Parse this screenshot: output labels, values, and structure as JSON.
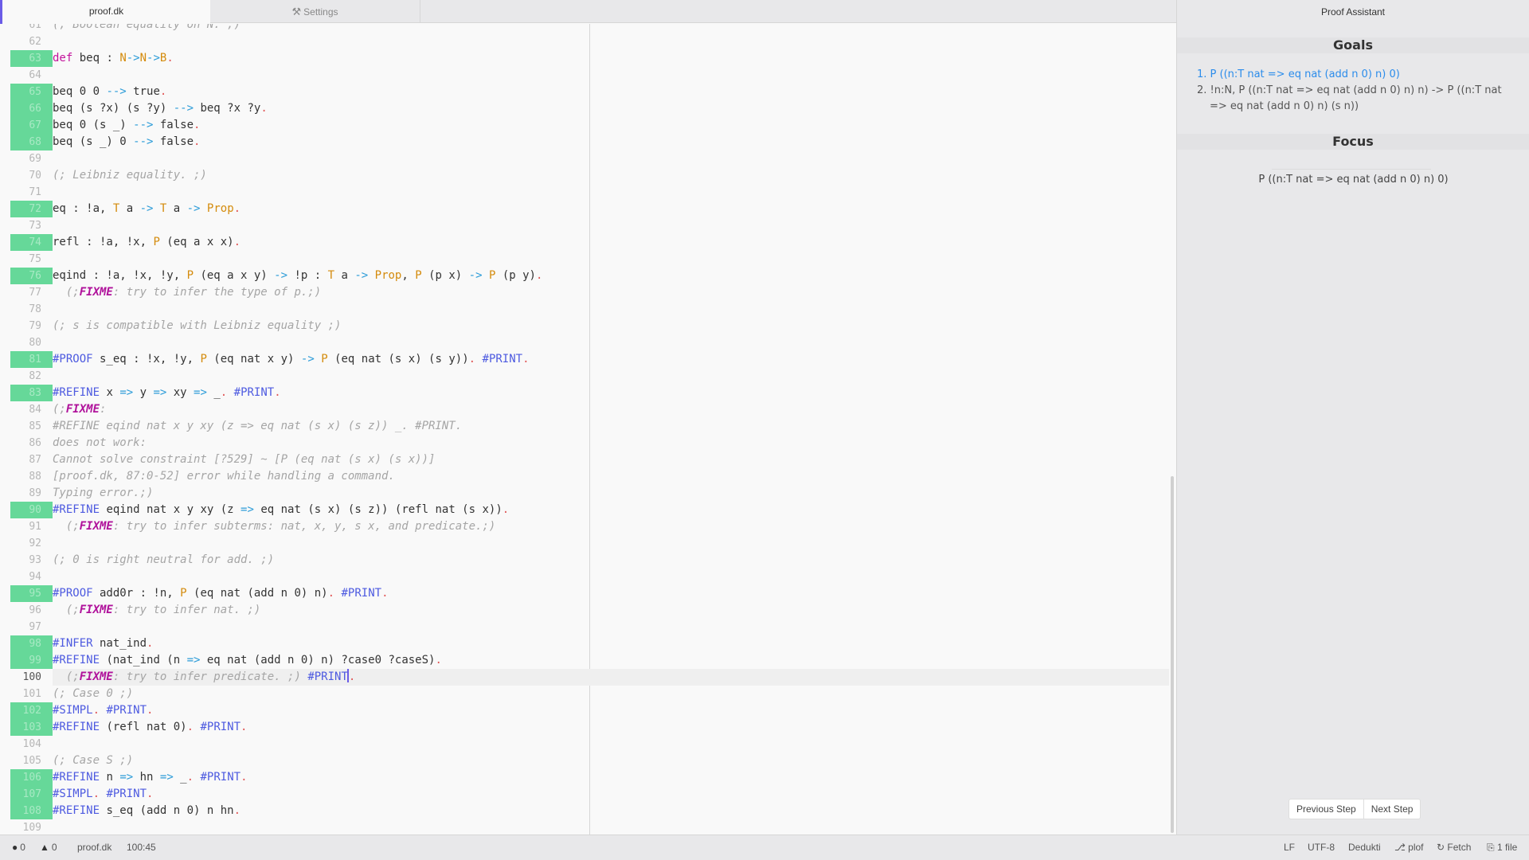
{
  "tabs": [
    {
      "label": "proof.dk",
      "active": true
    },
    {
      "label": "Settings",
      "icon": "tools-icon",
      "active": false
    }
  ],
  "editor": {
    "cursor_line": 100,
    "lines": [
      {
        "n": "61",
        "ok": false,
        "tokens": [
          [
            "cm",
            "(; Boolean equality on N. ;)"
          ]
        ]
      },
      {
        "n": "62",
        "ok": false,
        "tokens": []
      },
      {
        "n": "63",
        "ok": true,
        "tokens": [
          [
            "kw",
            "def"
          ],
          [
            "",
            " beq : "
          ],
          [
            "ty",
            "N"
          ],
          [
            "ar",
            "->"
          ],
          [
            "ty",
            "N"
          ],
          [
            "ar",
            "->"
          ],
          [
            "ty",
            "B"
          ],
          [
            "dot",
            "."
          ]
        ]
      },
      {
        "n": "64",
        "ok": false,
        "tokens": []
      },
      {
        "n": "65",
        "ok": true,
        "tokens": [
          [
            "",
            "beq 0 0 "
          ],
          [
            "ar",
            "-->"
          ],
          [
            "",
            " true"
          ],
          [
            "dot",
            "."
          ]
        ]
      },
      {
        "n": "66",
        "ok": true,
        "tokens": [
          [
            "",
            "beq (s ?x) (s ?y) "
          ],
          [
            "ar",
            "-->"
          ],
          [
            "",
            " beq ?x ?y"
          ],
          [
            "dot",
            "."
          ]
        ]
      },
      {
        "n": "67",
        "ok": true,
        "tokens": [
          [
            "",
            "beq 0 (s _) "
          ],
          [
            "ar",
            "-->"
          ],
          [
            "",
            " false"
          ],
          [
            "dot",
            "."
          ]
        ]
      },
      {
        "n": "68",
        "ok": true,
        "tokens": [
          [
            "",
            "beq (s _) 0 "
          ],
          [
            "ar",
            "-->"
          ],
          [
            "",
            " false"
          ],
          [
            "dot",
            "."
          ]
        ]
      },
      {
        "n": "69",
        "ok": false,
        "tokens": []
      },
      {
        "n": "70",
        "ok": false,
        "tokens": [
          [
            "cm",
            "(; Leibniz equality. ;)"
          ]
        ]
      },
      {
        "n": "71",
        "ok": false,
        "tokens": []
      },
      {
        "n": "72",
        "ok": true,
        "tokens": [
          [
            "",
            "eq : !a, "
          ],
          [
            "ty",
            "T"
          ],
          [
            "",
            " a "
          ],
          [
            "ar",
            "->"
          ],
          [
            "",
            " "
          ],
          [
            "ty",
            "T"
          ],
          [
            "",
            " a "
          ],
          [
            "ar",
            "->"
          ],
          [
            "",
            " "
          ],
          [
            "ty",
            "Prop"
          ],
          [
            "dot",
            "."
          ]
        ]
      },
      {
        "n": "73",
        "ok": false,
        "tokens": []
      },
      {
        "n": "74",
        "ok": true,
        "tokens": [
          [
            "",
            "refl : !a, !x, "
          ],
          [
            "ty",
            "P"
          ],
          [
            "",
            " (eq a x x)"
          ],
          [
            "dot",
            "."
          ]
        ]
      },
      {
        "n": "75",
        "ok": false,
        "tokens": []
      },
      {
        "n": "76",
        "ok": true,
        "tokens": [
          [
            "",
            "eqind : !a, !x, !y, "
          ],
          [
            "ty",
            "P"
          ],
          [
            "",
            " (eq a x y) "
          ],
          [
            "ar",
            "->"
          ],
          [
            "",
            " !p : "
          ],
          [
            "ty",
            "T"
          ],
          [
            "",
            " a "
          ],
          [
            "ar",
            "->"
          ],
          [
            "",
            " "
          ],
          [
            "ty",
            "Prop"
          ],
          [
            "",
            ", "
          ],
          [
            "ty",
            "P"
          ],
          [
            "",
            " (p x) "
          ],
          [
            "ar",
            "->"
          ],
          [
            "",
            " "
          ],
          [
            "ty",
            "P"
          ],
          [
            "",
            " (p y)"
          ],
          [
            "dot",
            "."
          ]
        ]
      },
      {
        "n": "77",
        "ok": false,
        "tokens": [
          [
            "cm",
            "  (;"
          ],
          [
            "fx",
            "FIXME"
          ],
          [
            "cm",
            ": try to infer the type of p.;)"
          ]
        ]
      },
      {
        "n": "78",
        "ok": false,
        "tokens": []
      },
      {
        "n": "79",
        "ok": false,
        "tokens": [
          [
            "cm",
            "(; s is compatible with Leibniz equality ;)"
          ]
        ]
      },
      {
        "n": "80",
        "ok": false,
        "tokens": []
      },
      {
        "n": "81",
        "ok": true,
        "tokens": [
          [
            "cmd",
            "#PROOF"
          ],
          [
            "",
            " s_eq : !x, !y, "
          ],
          [
            "ty",
            "P"
          ],
          [
            "",
            " (eq nat x y) "
          ],
          [
            "ar",
            "->"
          ],
          [
            "",
            " "
          ],
          [
            "ty",
            "P"
          ],
          [
            "",
            " (eq nat (s x) (s y))"
          ],
          [
            "dot",
            "."
          ],
          [
            "",
            " "
          ],
          [
            "cmd",
            "#PRINT"
          ],
          [
            "dot",
            "."
          ]
        ]
      },
      {
        "n": "82",
        "ok": false,
        "tokens": []
      },
      {
        "n": "83",
        "ok": true,
        "tokens": [
          [
            "cmd",
            "#REFINE"
          ],
          [
            "",
            " x "
          ],
          [
            "ar",
            "=>"
          ],
          [
            "",
            " y "
          ],
          [
            "ar",
            "=>"
          ],
          [
            "",
            " xy "
          ],
          [
            "ar",
            "=>"
          ],
          [
            "",
            " _"
          ],
          [
            "dot",
            "."
          ],
          [
            "",
            " "
          ],
          [
            "cmd",
            "#PRINT"
          ],
          [
            "dot",
            "."
          ]
        ]
      },
      {
        "n": "84",
        "ok": false,
        "tokens": [
          [
            "cm",
            "(;"
          ],
          [
            "fx",
            "FIXME"
          ],
          [
            "cm",
            ":"
          ]
        ]
      },
      {
        "n": "85",
        "ok": false,
        "tokens": [
          [
            "cm",
            "#REFINE eqind nat x y xy (z => eq nat (s x) (s z)) _. #PRINT."
          ]
        ]
      },
      {
        "n": "86",
        "ok": false,
        "tokens": [
          [
            "cm",
            "does not work:"
          ]
        ]
      },
      {
        "n": "87",
        "ok": false,
        "tokens": [
          [
            "cm",
            "Cannot solve constraint [?529] ~ [P (eq nat (s x) (s x))]"
          ]
        ]
      },
      {
        "n": "88",
        "ok": false,
        "tokens": [
          [
            "cm",
            "[proof.dk, 87:0-52] error while handling a command."
          ]
        ]
      },
      {
        "n": "89",
        "ok": false,
        "tokens": [
          [
            "cm",
            "Typing error.;)"
          ]
        ]
      },
      {
        "n": "90",
        "ok": true,
        "tokens": [
          [
            "cmd",
            "#REFINE"
          ],
          [
            "",
            " eqind nat x y xy (z "
          ],
          [
            "ar",
            "=>"
          ],
          [
            "",
            " eq nat (s x) (s z)) (refl nat (s x))"
          ],
          [
            "dot",
            "."
          ]
        ]
      },
      {
        "n": "91",
        "ok": false,
        "tokens": [
          [
            "cm",
            "  (;"
          ],
          [
            "fx",
            "FIXME"
          ],
          [
            "cm",
            ": try to infer subterms: nat, x, y, s x, and predicate.;)"
          ]
        ]
      },
      {
        "n": "92",
        "ok": false,
        "tokens": []
      },
      {
        "n": "93",
        "ok": false,
        "tokens": [
          [
            "cm",
            "(; 0 is right neutral for add. ;)"
          ]
        ]
      },
      {
        "n": "94",
        "ok": false,
        "tokens": []
      },
      {
        "n": "95",
        "ok": true,
        "tokens": [
          [
            "cmd",
            "#PROOF"
          ],
          [
            "",
            " add0r : !n, "
          ],
          [
            "ty",
            "P"
          ],
          [
            "",
            " (eq nat (add n 0) n)"
          ],
          [
            "dot",
            "."
          ],
          [
            "",
            " "
          ],
          [
            "cmd",
            "#PRINT"
          ],
          [
            "dot",
            "."
          ]
        ]
      },
      {
        "n": "96",
        "ok": false,
        "tokens": [
          [
            "cm",
            "  (;"
          ],
          [
            "fx",
            "FIXME"
          ],
          [
            "cm",
            ": try to infer nat. ;)"
          ]
        ]
      },
      {
        "n": "97",
        "ok": false,
        "tokens": []
      },
      {
        "n": "98",
        "ok": true,
        "tokens": [
          [
            "cmd",
            "#INFER"
          ],
          [
            "",
            " nat_ind"
          ],
          [
            "dot",
            "."
          ]
        ]
      },
      {
        "n": "99",
        "ok": true,
        "tokens": [
          [
            "cmd",
            "#REFINE"
          ],
          [
            "",
            " (nat_ind (n "
          ],
          [
            "ar",
            "=>"
          ],
          [
            "",
            " eq nat (add n 0) n) ?case0 ?caseS)"
          ],
          [
            "dot",
            "."
          ]
        ]
      },
      {
        "n": "100",
        "ok": false,
        "current": true,
        "tokens": [
          [
            "cm",
            "  (;"
          ],
          [
            "fx",
            "FIXME"
          ],
          [
            "cm",
            ": try to infer predicate. ;)"
          ],
          [
            "",
            " "
          ],
          [
            "cmd",
            "#PRINT"
          ],
          [
            "cursor",
            ""
          ],
          [
            "dot",
            "."
          ]
        ]
      },
      {
        "n": "101",
        "ok": false,
        "tokens": [
          [
            "cm",
            "(; Case 0 ;)"
          ]
        ]
      },
      {
        "n": "102",
        "ok": true,
        "tokens": [
          [
            "cmd",
            "#SIMPL"
          ],
          [
            "dot",
            "."
          ],
          [
            "",
            " "
          ],
          [
            "cmd",
            "#PRINT"
          ],
          [
            "dot",
            "."
          ]
        ]
      },
      {
        "n": "103",
        "ok": true,
        "tokens": [
          [
            "cmd",
            "#REFINE"
          ],
          [
            "",
            " (refl nat 0)"
          ],
          [
            "dot",
            "."
          ],
          [
            "",
            " "
          ],
          [
            "cmd",
            "#PRINT"
          ],
          [
            "dot",
            "."
          ]
        ]
      },
      {
        "n": "104",
        "ok": false,
        "tokens": []
      },
      {
        "n": "105",
        "ok": false,
        "tokens": [
          [
            "cm",
            "(; Case S ;)"
          ]
        ]
      },
      {
        "n": "106",
        "ok": true,
        "tokens": [
          [
            "cmd",
            "#REFINE"
          ],
          [
            "",
            " n "
          ],
          [
            "ar",
            "=>"
          ],
          [
            "",
            " hn "
          ],
          [
            "ar",
            "=>"
          ],
          [
            "",
            " _"
          ],
          [
            "dot",
            "."
          ],
          [
            "",
            " "
          ],
          [
            "cmd",
            "#PRINT"
          ],
          [
            "dot",
            "."
          ]
        ]
      },
      {
        "n": "107",
        "ok": true,
        "tokens": [
          [
            "cmd",
            "#SIMPL"
          ],
          [
            "dot",
            "."
          ],
          [
            "",
            " "
          ],
          [
            "cmd",
            "#PRINT"
          ],
          [
            "dot",
            "."
          ]
        ]
      },
      {
        "n": "108",
        "ok": true,
        "tokens": [
          [
            "cmd",
            "#REFINE"
          ],
          [
            "",
            " s_eq (add n 0) n hn"
          ],
          [
            "dot",
            "."
          ]
        ]
      },
      {
        "n": "109",
        "ok": false,
        "tokens": []
      }
    ]
  },
  "panel": {
    "title": "Proof Assistant",
    "goals_heading": "Goals",
    "goals": [
      {
        "text": "1. P ((n:T nat => eq nat (add n 0) n) 0)",
        "selected": true
      },
      {
        "text": "2. !n:N, P ((n:T nat => eq nat (add n 0) n) n) -> P ((n:T nat => eq nat (add n 0) n) (s n))",
        "selected": false
      }
    ],
    "focus_heading": "Focus",
    "focus_text": "P ((n:T nat => eq nat (add n 0) n) 0)",
    "prev_button": "Previous Step",
    "next_button": "Next Step"
  },
  "statusbar": {
    "errors": "0",
    "warnings": "0",
    "file": "proof.dk",
    "cursor_pos": "100:45",
    "line_ending": "LF",
    "encoding": "UTF-8",
    "grammar": "Dedukti",
    "branch": "plof",
    "fetch": "Fetch",
    "changes": "1 file"
  }
}
